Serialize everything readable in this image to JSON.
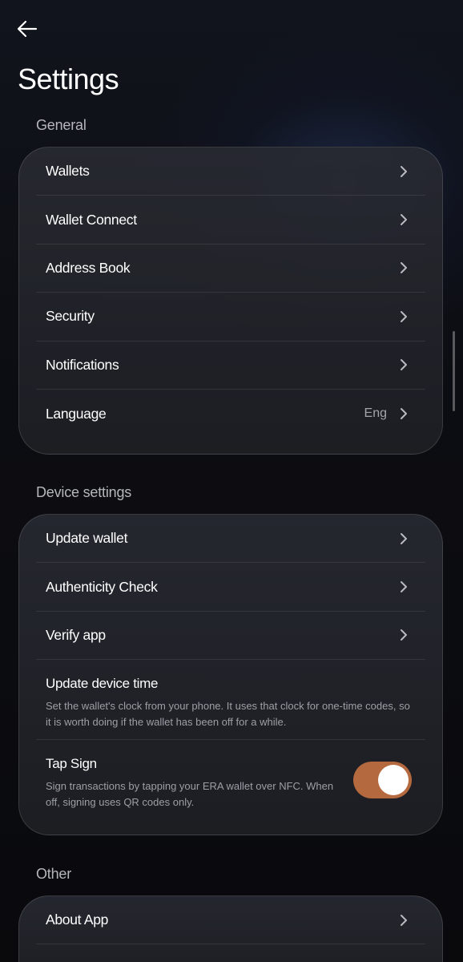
{
  "header": {
    "back_icon": "arrow-left-icon",
    "title": "Settings"
  },
  "sections": {
    "general": {
      "label": "General",
      "items": [
        {
          "label": "Wallets"
        },
        {
          "label": "Wallet Connect"
        },
        {
          "label": "Address Book"
        },
        {
          "label": "Security"
        },
        {
          "label": "Notifications"
        },
        {
          "label": "Language",
          "value": "Eng"
        }
      ]
    },
    "device": {
      "label": "Device settings",
      "items": [
        {
          "label": "Update wallet"
        },
        {
          "label": "Authenticity Check"
        },
        {
          "label": "Verify app"
        },
        {
          "label": "Update device time",
          "description": "Set the wallet's clock from your phone. It uses that clock for one-time codes, so it is worth doing if the wallet has been off for a while."
        },
        {
          "label": "Tap Sign",
          "description": "Sign transactions by tapping your ERA wallet over NFC. When off, signing uses QR codes only.",
          "toggle_on": true
        }
      ]
    },
    "other": {
      "label": "Other",
      "items": [
        {
          "label": "About App"
        }
      ]
    }
  },
  "colors": {
    "background": "#0b0c10",
    "card": "#25262c",
    "toggle_active": "#b46a3e",
    "text_primary": "#ffffff",
    "text_secondary": "#9d9fa6"
  }
}
